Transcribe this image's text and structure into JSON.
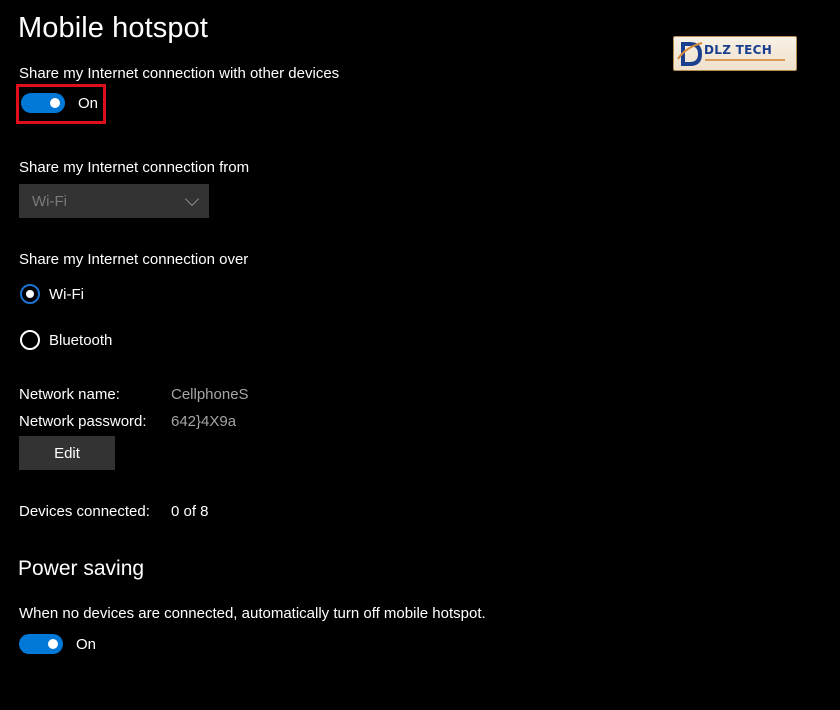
{
  "page": {
    "title": "Mobile hotspot"
  },
  "share": {
    "label": "Share my Internet connection with other devices",
    "toggle_state": "On",
    "toggle_on": true
  },
  "from": {
    "label": "Share my Internet connection from",
    "selected": "Wi-Fi"
  },
  "over": {
    "label": "Share my Internet connection over",
    "options": [
      {
        "label": "Wi-Fi",
        "checked": true
      },
      {
        "label": "Bluetooth",
        "checked": false
      }
    ]
  },
  "network": {
    "name_label": "Network name:",
    "name_value": "CellphoneS",
    "password_label": "Network password:",
    "password_value": "642}4X9a",
    "edit_label": "Edit"
  },
  "devices": {
    "label": "Devices connected:",
    "value": "0 of 8"
  },
  "power_saving": {
    "title": "Power saving",
    "description": "When no devices are connected, automatically turn off mobile hotspot.",
    "toggle_state": "On",
    "toggle_on": true
  },
  "logo": {
    "text": "DLZ TECH"
  },
  "colors": {
    "accent": "#0078d7",
    "highlight": "#e0101b",
    "background": "#000000",
    "control_bg": "#333333"
  },
  "icons": {
    "dropdown": "chevron-down-icon",
    "logo": "dlz-tech-logo"
  }
}
